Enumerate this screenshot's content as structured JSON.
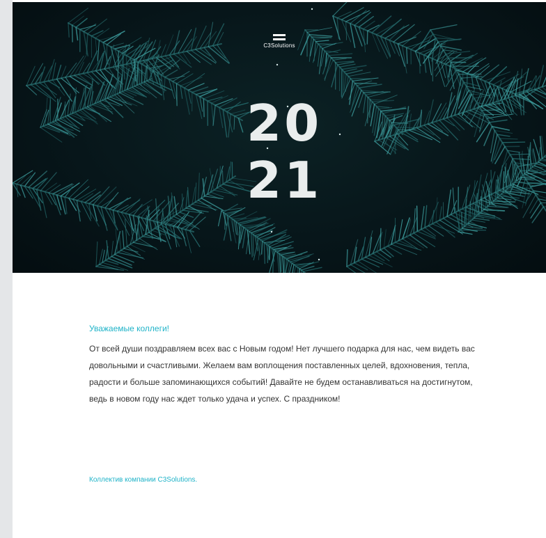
{
  "brand": {
    "logo_text": "C3Solutions",
    "accent_color": "#1fb3c8"
  },
  "hero": {
    "year_top": "20",
    "year_bottom": "21",
    "background": "pine-branches-image"
  },
  "letter": {
    "greeting": "Уважаемые коллеги!",
    "body": "От всей души поздравляем всех вас с Новым годом! Нет лучшего подарка для нас, чем видеть вас довольными и счастливыми. Желаем вам воплощения поставленных целей, вдохновения, тепла, радости и больше запоминающихся событий! Давайте не будем останавливаться на достигнутом, ведь в новом году нас ждет только удача и успех. С праздником!",
    "signature": "Коллектив компании C3Solutions."
  }
}
